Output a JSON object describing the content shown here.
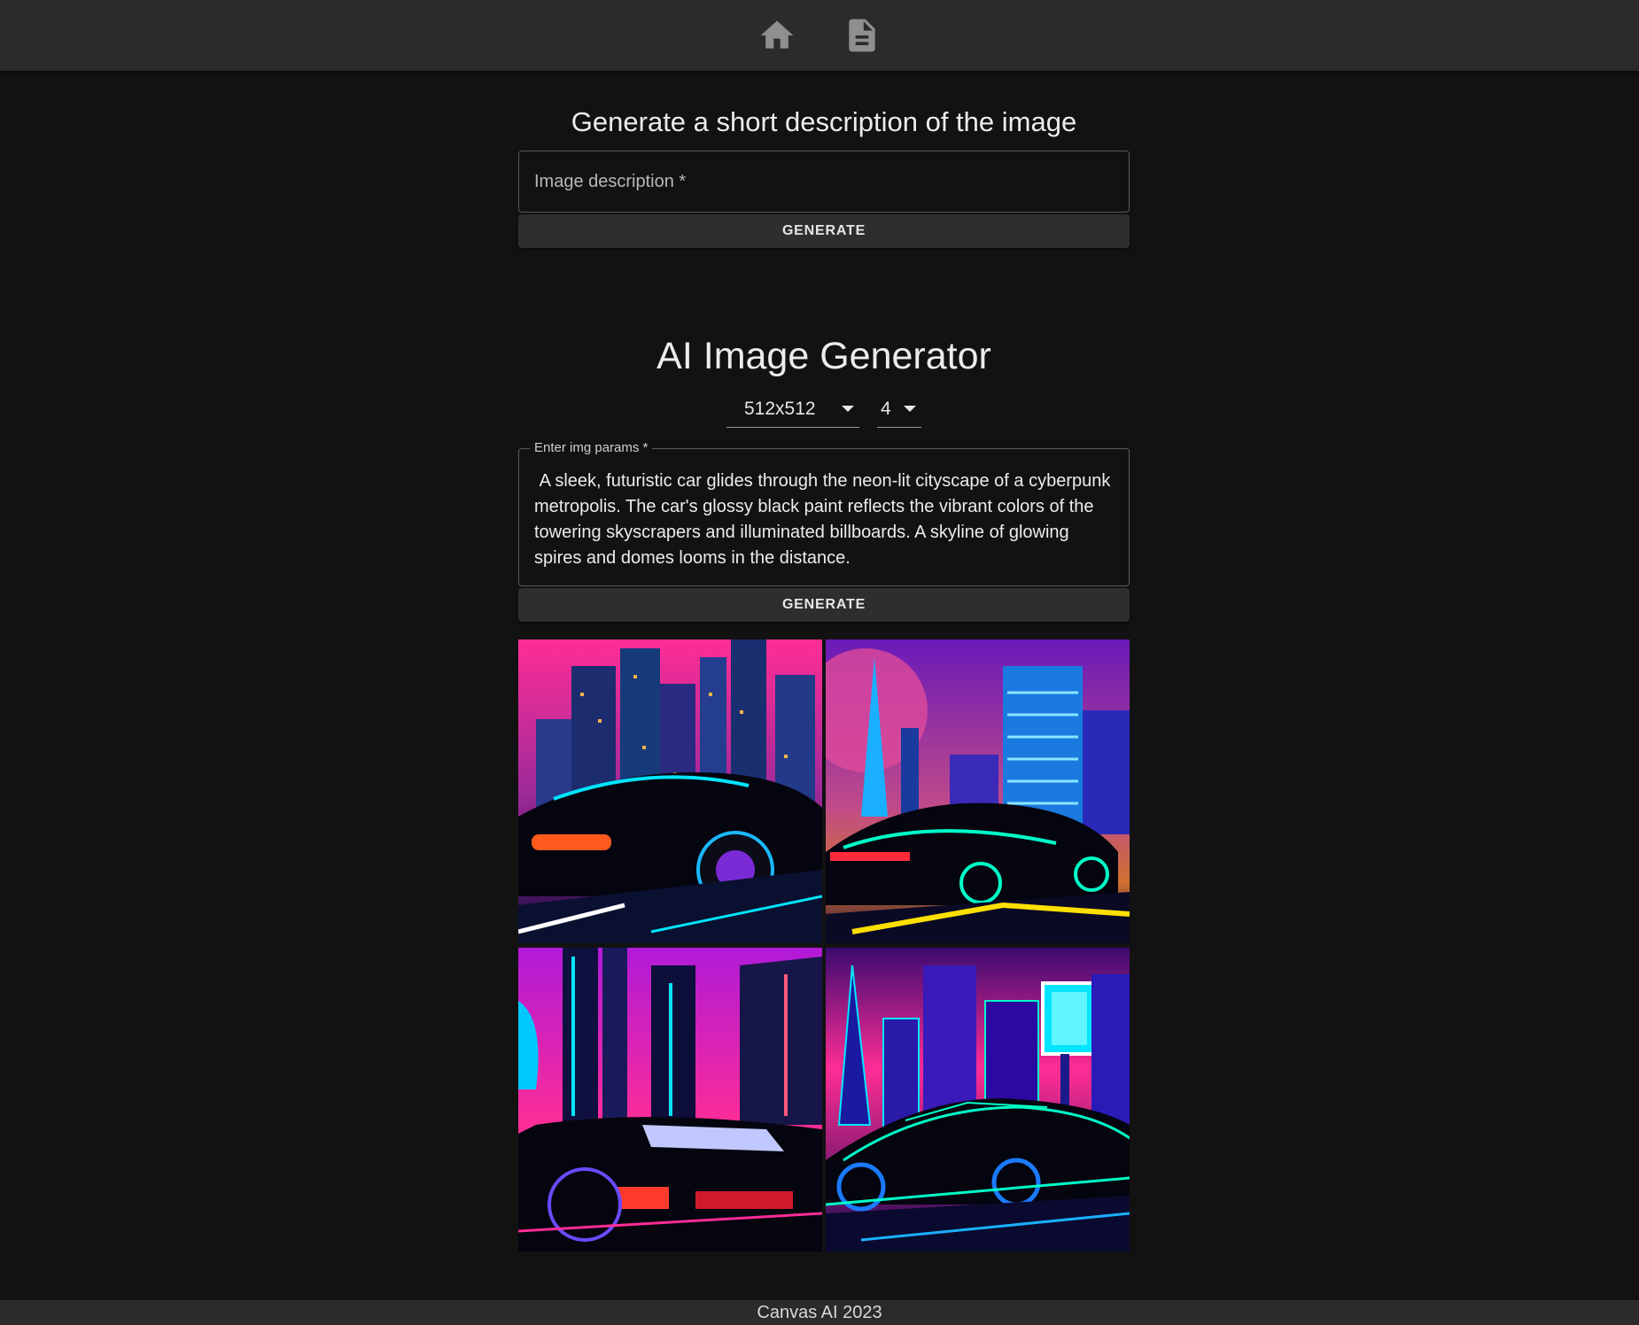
{
  "nav": {
    "home_icon": "home-icon",
    "document_icon": "document-icon"
  },
  "description_section": {
    "title": "Generate a short description of the image",
    "input_placeholder": "Image description *",
    "button_label": "Generate"
  },
  "generator_section": {
    "title": "AI Image Generator",
    "size_select": {
      "selected": "512x512"
    },
    "count_select": {
      "selected": "4"
    },
    "params_label": "Enter img params *",
    "params_value": " A sleek, futuristic car glides through the neon-lit cityscape of a cyberpunk metropolis. The car's glossy black paint reflects the vibrant colors of the towering skyscrapers and illuminated billboards. A skyline of glowing spires and domes looms in the distance.",
    "button_label": "Generate"
  },
  "footer": {
    "text": "Canvas AI 2023"
  },
  "colors": {
    "background": "#121212",
    "bar": "#2b2b2b",
    "button": "#2e2e2e",
    "neon_pink": "#ff2d95",
    "neon_cyan": "#00e5ff",
    "neon_purple": "#8a2be2"
  }
}
